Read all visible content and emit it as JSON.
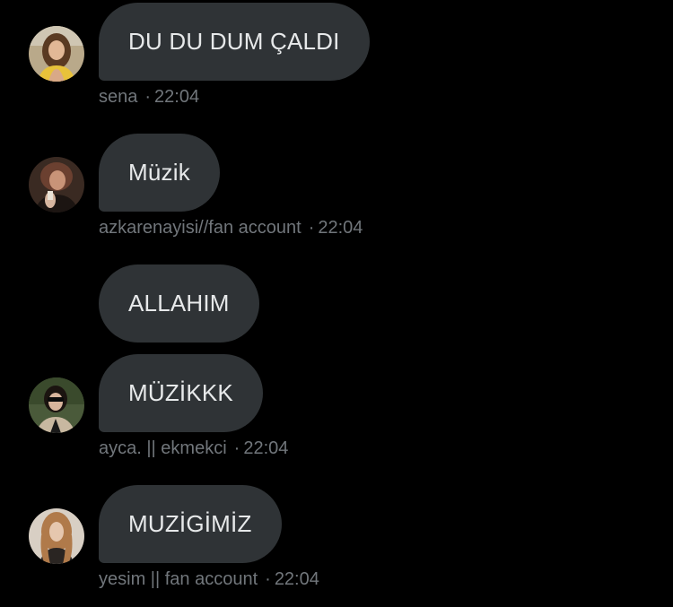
{
  "colors": {
    "background": "#000000",
    "bubble": "#2f3336",
    "text": "#e7e9ea",
    "meta": "#71767b"
  },
  "messages": [
    {
      "text": "DU DU DUM ÇALDI",
      "author": "sena",
      "time": "22:04",
      "avatar": "avatar-icon"
    },
    {
      "text": "Müzik",
      "author": "azkarenayisi//fan account",
      "time": "22:04",
      "avatar": "avatar-icon"
    },
    {
      "text": "ALLAHIM"
    },
    {
      "text": "MÜZİKKK",
      "author": "ayca. || ekmekci",
      "time": "22:04",
      "avatar": "avatar-icon"
    },
    {
      "text": "MUZİGİMİZ",
      "author": "yesim || fan account",
      "time": "22:04",
      "avatar": "avatar-icon"
    }
  ],
  "separator": "·"
}
